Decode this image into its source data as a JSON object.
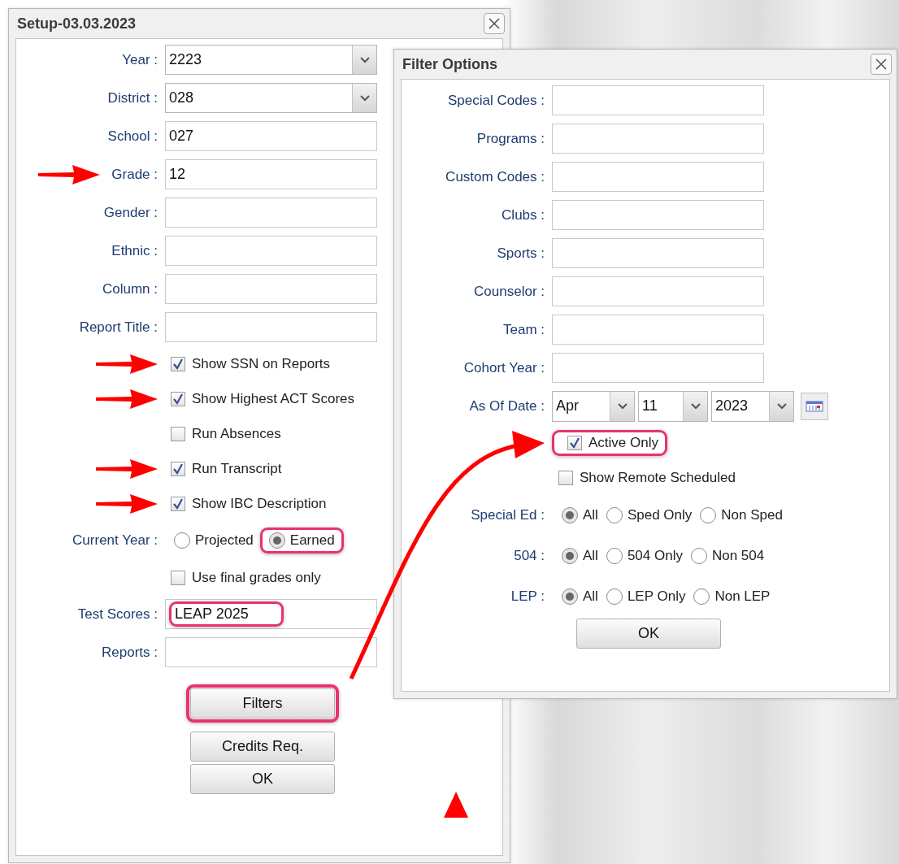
{
  "setup_dialog": {
    "title": "Setup-03.03.2023",
    "rows": [
      {
        "kind": "select",
        "label": "Year :",
        "value": "2223",
        "pointer": false,
        "highlighted": false
      },
      {
        "kind": "select",
        "label": "District :",
        "value": "028",
        "pointer": false,
        "highlighted": false
      },
      {
        "kind": "text",
        "label": "School :",
        "value": "027",
        "pointer": false,
        "highlighted": false
      },
      {
        "kind": "text",
        "label": "Grade :",
        "value": "12",
        "pointer": true,
        "highlighted": false
      },
      {
        "kind": "text",
        "label": "Gender :",
        "pointer": false,
        "highlighted": false
      },
      {
        "kind": "text",
        "label": "Ethnic :",
        "pointer": false,
        "highlighted": false
      },
      {
        "kind": "text",
        "label": "Column :",
        "pointer": false,
        "highlighted": false
      },
      {
        "kind": "text",
        "label": "Report Title :",
        "pointer": false,
        "highlighted": false
      },
      {
        "kind": "checkbox",
        "label": "Show SSN on Reports",
        "checked": true,
        "pointer": true,
        "highlighted": false
      },
      {
        "kind": "checkbox",
        "label": "Show Highest ACT Scores",
        "checked": true,
        "pointer": true,
        "highlighted": false
      },
      {
        "kind": "checkbox",
        "label": "Run Absences",
        "checked": false,
        "pointer": false,
        "highlighted": false
      },
      {
        "kind": "checkbox",
        "label": "Run Transcript",
        "checked": true,
        "pointer": true,
        "highlighted": false
      },
      {
        "kind": "checkbox",
        "label": "Show IBC Description",
        "checked": true,
        "pointer": true,
        "highlighted": false
      },
      {
        "kind": "radio",
        "label": "Current Year :",
        "pointer": false,
        "options": [
          {
            "label": "Projected",
            "selected": false,
            "highlighted": false
          },
          {
            "label": "Earned",
            "selected": true,
            "highlighted": true
          }
        ]
      },
      {
        "kind": "checkbox",
        "label": "Use final grades only",
        "checked": false,
        "pointer": false,
        "highlighted": false
      },
      {
        "kind": "text",
        "label": "Test Scores :",
        "value": "LEAP 2025",
        "pointer": false,
        "highlighted": true
      },
      {
        "kind": "text",
        "label": "Reports :",
        "pointer": false,
        "highlighted": false
      }
    ],
    "buttons": [
      {
        "label": "Filters",
        "highlighted": true
      },
      {
        "label": "Credits Req.",
        "highlighted": false
      },
      {
        "label": "OK",
        "highlighted": false
      }
    ]
  },
  "filter_dialog": {
    "title": "Filter Options",
    "rows": [
      {
        "kind": "text",
        "label": "Special Codes :",
        "pointer": false,
        "highlighted": false
      },
      {
        "kind": "text",
        "label": "Programs :",
        "pointer": false,
        "highlighted": false
      },
      {
        "kind": "text",
        "label": "Custom Codes :",
        "pointer": false,
        "highlighted": false
      },
      {
        "kind": "text",
        "label": "Clubs :",
        "pointer": false,
        "highlighted": false
      },
      {
        "kind": "text",
        "label": "Sports :",
        "pointer": false,
        "highlighted": false
      },
      {
        "kind": "text",
        "label": "Counselor :",
        "pointer": false,
        "highlighted": false
      },
      {
        "kind": "text",
        "label": "Team :",
        "pointer": false,
        "highlighted": false
      },
      {
        "kind": "text",
        "label": "Cohort Year :",
        "pointer": false,
        "highlighted": false
      },
      {
        "kind": "date",
        "label": "As Of Date :",
        "month": "Apr",
        "day": "11",
        "year": "2023",
        "pointer": false
      },
      {
        "kind": "checkbox",
        "label": "Active Only",
        "checked": true,
        "pointer": false,
        "highlighted": true
      },
      {
        "kind": "checkbox",
        "label": "Show Remote Scheduled",
        "checked": false,
        "pointer": false,
        "highlighted": false
      },
      {
        "kind": "radio",
        "label": "Special Ed :",
        "pointer": false,
        "options": [
          {
            "label": "All",
            "selected": true,
            "highlighted": false
          },
          {
            "label": "Sped Only",
            "selected": false,
            "highlighted": false
          },
          {
            "label": "Non Sped",
            "selected": false,
            "highlighted": false
          }
        ]
      },
      {
        "kind": "radio",
        "label": "504 :",
        "pointer": false,
        "options": [
          {
            "label": "All",
            "selected": true,
            "highlighted": false
          },
          {
            "label": "504 Only",
            "selected": false,
            "highlighted": false
          },
          {
            "label": "Non 504",
            "selected": false,
            "highlighted": false
          }
        ]
      },
      {
        "kind": "radio",
        "label": "LEP :",
        "pointer": false,
        "options": [
          {
            "label": "All",
            "selected": true,
            "highlighted": false
          },
          {
            "label": "LEP Only",
            "selected": false,
            "highlighted": false
          },
          {
            "label": "Non LEP",
            "selected": false,
            "highlighted": false
          }
        ]
      }
    ],
    "buttons": [
      {
        "label": "OK",
        "highlighted": false
      }
    ]
  },
  "annotations": {
    "curved_arrow": true,
    "triangle": true
  }
}
